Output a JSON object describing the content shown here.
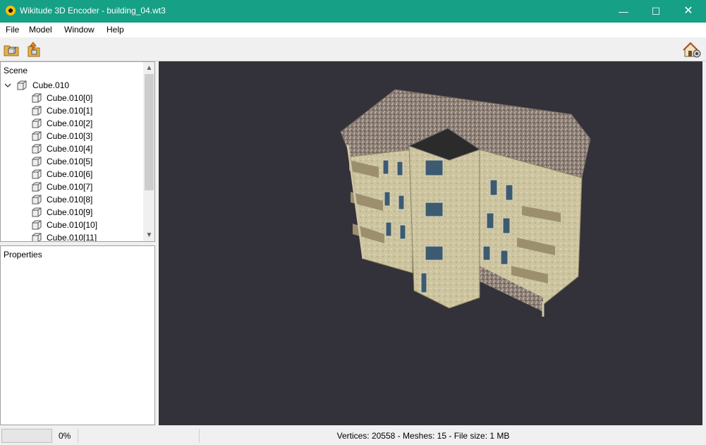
{
  "window": {
    "title": "Wikitude 3D Encoder - building_04.wt3",
    "controls": {
      "minimize": "—",
      "maximize": "☐",
      "close": "✕"
    }
  },
  "menu": [
    "File",
    "Model",
    "Window",
    "Help"
  ],
  "toolbar": {
    "open_icon": "open-model-icon",
    "export_icon": "export-icon",
    "right_icon": "preview-icon"
  },
  "scene": {
    "title": "Scene",
    "root": "Cube.010",
    "children": [
      "Cube.010[0]",
      "Cube.010[1]",
      "Cube.010[2]",
      "Cube.010[3]",
      "Cube.010[4]",
      "Cube.010[5]",
      "Cube.010[6]",
      "Cube.010[7]",
      "Cube.010[8]",
      "Cube.010[9]",
      "Cube.010[10]",
      "Cube.010[11]"
    ]
  },
  "properties": {
    "title": "Properties"
  },
  "viewport": {
    "background": "#333139"
  },
  "status": {
    "progress_value": 0,
    "progress_label": "0%",
    "info": "Vertices: 20558 - Meshes: 15 - File size: 1 MB"
  },
  "colors": {
    "titlebar": "#16a085"
  }
}
